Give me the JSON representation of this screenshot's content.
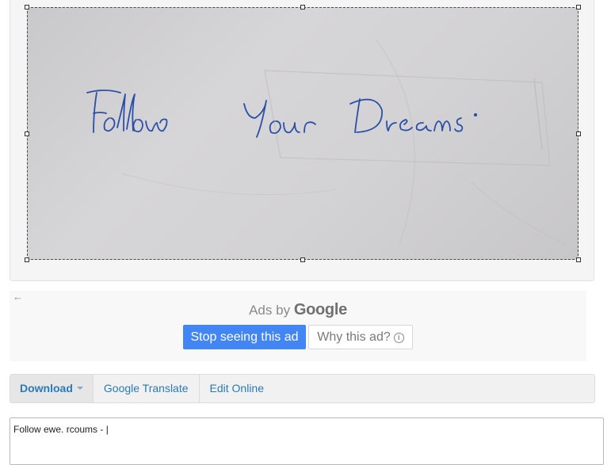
{
  "image": {
    "handwritten_text": "Follow Your Dreams."
  },
  "ad": {
    "back_icon": "←",
    "ads_by_label": "Ads by",
    "google_label": "Google",
    "stop_button_label": "Stop seeing this ad",
    "why_button_label": "Why this ad?",
    "info_icon": "i"
  },
  "toolbar": {
    "download_label": "Download",
    "translate_label": "Google Translate",
    "edit_label": "Edit Online"
  },
  "output": {
    "value": "Follow ewe. rcoums - |"
  },
  "colors": {
    "accent": "#4285f4",
    "link": "#2a7ab8",
    "ink": "#2b4fa8"
  }
}
